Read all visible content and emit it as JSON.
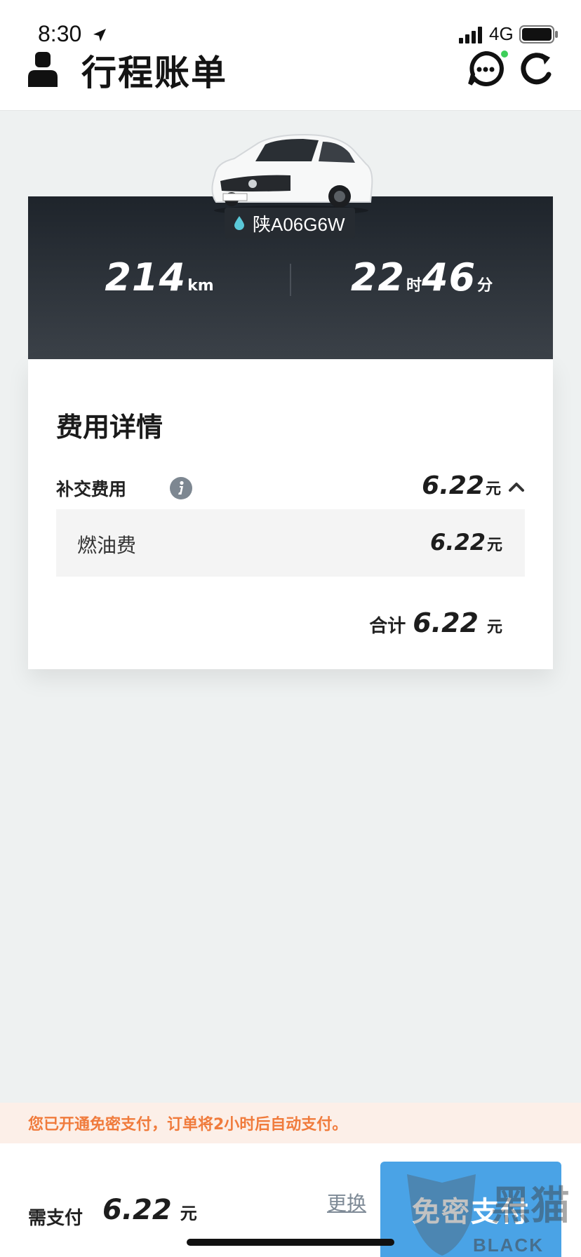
{
  "status_bar": {
    "time": "8:30",
    "network": "4G"
  },
  "header": {
    "title": "行程账单"
  },
  "trip": {
    "plate": "陕A06G6W",
    "distance_value": "214",
    "distance_unit": "km",
    "duration_hours": "22",
    "hours_unit": "时",
    "duration_minutes": "46",
    "minutes_unit": "分"
  },
  "fee_details": {
    "title": "费用详情",
    "extra_fee_label": "补交费用",
    "extra_fee_amount": "6.22",
    "currency_unit": "元",
    "items": [
      {
        "label": "燃油费",
        "amount": "6.22"
      }
    ],
    "total_label": "合计",
    "total_amount": "6.22"
  },
  "notice": {
    "text": "您已开通免密支付，订单将2小时后自动支付。"
  },
  "payment": {
    "due_label": "需支付",
    "due_amount": "6.22",
    "change_label": "更换",
    "pay_button_label": "免密支付"
  },
  "watermark": {
    "text": "黑猫",
    "latin": "BLACK CAT"
  },
  "colors": {
    "accent_blue": "#4aa3e6",
    "notice_orange": "#f07b3c",
    "online_green": "#3ecf5a",
    "plate_drop": "#5ac8d8"
  },
  "icons": [
    "location-arrow-icon",
    "signal-icon",
    "battery-icon",
    "user-icon",
    "chat-icon",
    "refresh-icon",
    "water-drop-icon",
    "info-icon",
    "chevron-up-icon"
  ]
}
